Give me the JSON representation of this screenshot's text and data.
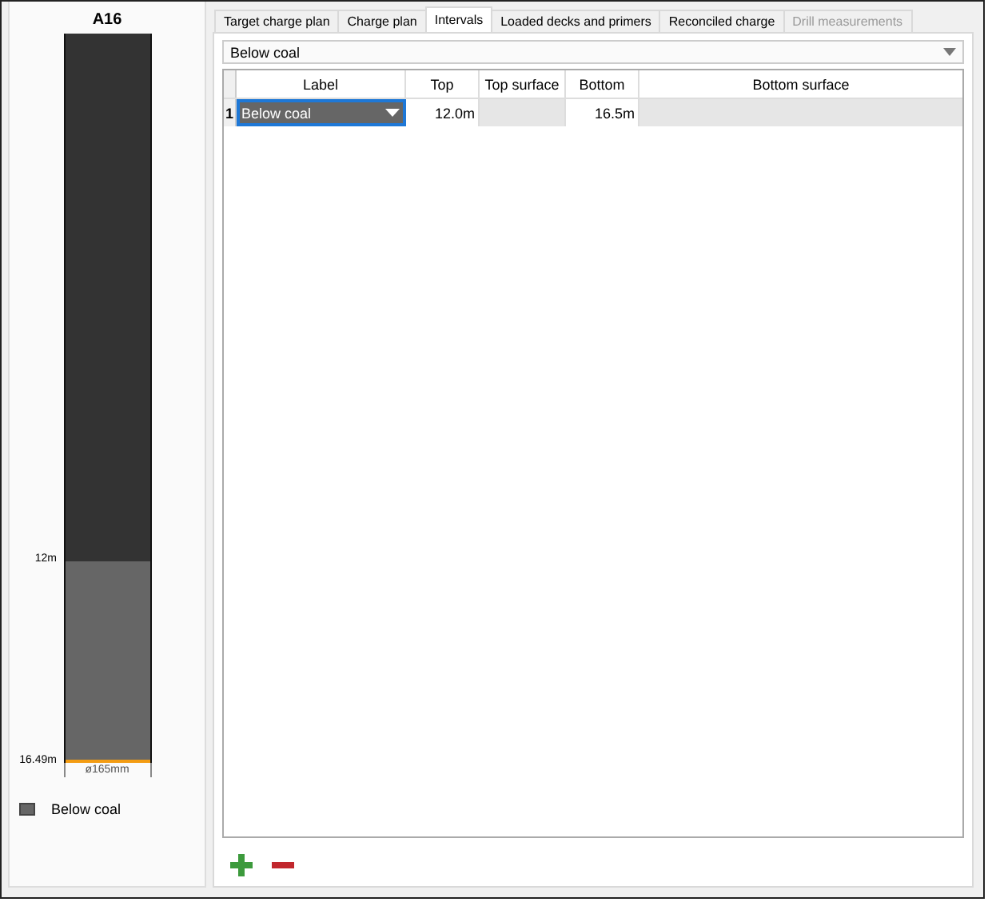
{
  "hole": {
    "title": "A16",
    "segments": [
      {
        "color": "#333333"
      },
      {
        "color": "#666666",
        "top_label": "12m"
      }
    ],
    "bottom_label": "16.49m",
    "diameter": "ø165mm",
    "legend": [
      {
        "label": "Below coal",
        "color": "#666666"
      }
    ]
  },
  "tabs": [
    {
      "label": "Target charge plan",
      "selected": false,
      "disabled": false
    },
    {
      "label": "Charge plan",
      "selected": false,
      "disabled": false
    },
    {
      "label": "Intervals",
      "selected": true,
      "disabled": false
    },
    {
      "label": "Loaded decks and primers",
      "selected": false,
      "disabled": false
    },
    {
      "label": "Reconciled charge",
      "selected": false,
      "disabled": false
    },
    {
      "label": "Drill measurements",
      "selected": false,
      "disabled": true
    }
  ],
  "interval_select": {
    "value": "Below coal"
  },
  "table": {
    "columns": [
      "Label",
      "Top",
      "Top surface",
      "Bottom",
      "Bottom surface"
    ],
    "rows": [
      {
        "number": "1",
        "label": "Below coal",
        "top": "12.0m",
        "top_surface": "",
        "bottom": "16.5m",
        "bottom_surface": "",
        "selected": true
      }
    ]
  },
  "buttons": [
    {
      "kind": "add"
    },
    {
      "kind": "remove"
    }
  ]
}
